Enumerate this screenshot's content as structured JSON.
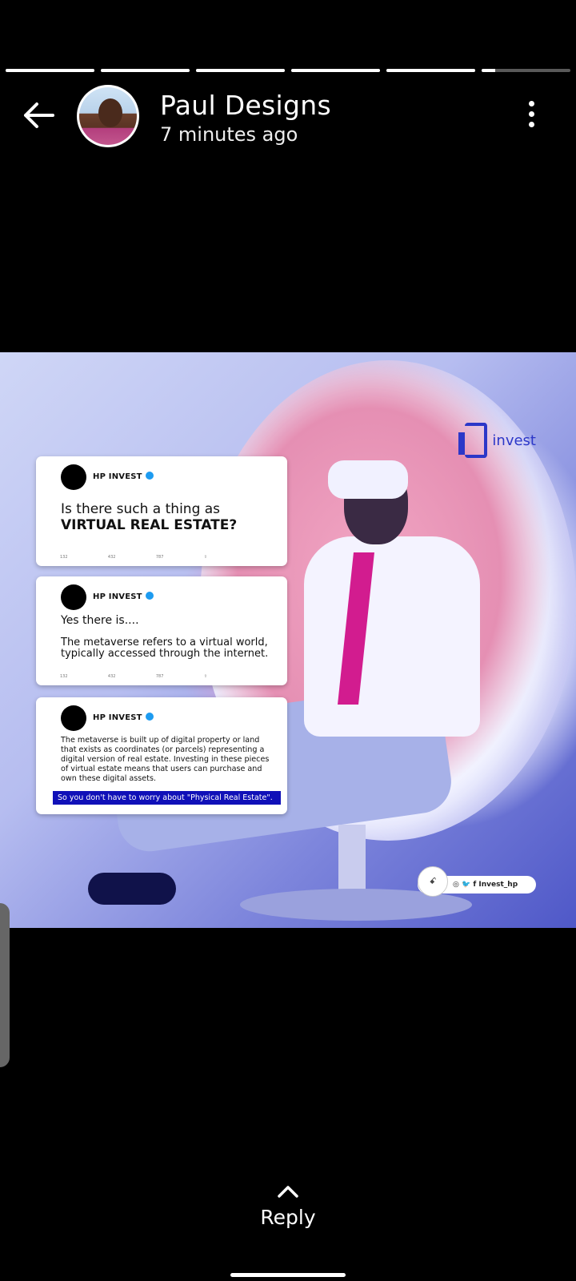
{
  "progress": {
    "segments": 6,
    "completed": 5,
    "current_fraction": 0.15
  },
  "header": {
    "author_name": "Paul Designs",
    "posted_time": "7 minutes ago"
  },
  "story": {
    "logo_text": "invest",
    "cards": [
      {
        "handle": "HP INVEST",
        "text_line1": "Is there such a thing as",
        "text_line2": "VIRTUAL REAL ESTATE?",
        "actions": [
          "132",
          "432",
          "787",
          ""
        ]
      },
      {
        "handle": "HP INVEST",
        "intro": "Yes there is....",
        "text": "The metaverse refers to a virtual world, typically accessed through the internet.",
        "actions": [
          "132",
          "432",
          "787",
          ""
        ]
      },
      {
        "handle": "HP INVEST",
        "text": "The metaverse is built up of digital property or land that exists as coordinates (or parcels) representing a digital version of real estate. Investing in these pieces of virtual estate means that users can purchase and own these digital assets.",
        "highlight": "So you don't have to worry about \"Physical Real Estate\"."
      }
    ],
    "social_handle": "f Invest_hp",
    "social_logo": "ꗃ"
  },
  "footer": {
    "reply_label": "Reply"
  }
}
